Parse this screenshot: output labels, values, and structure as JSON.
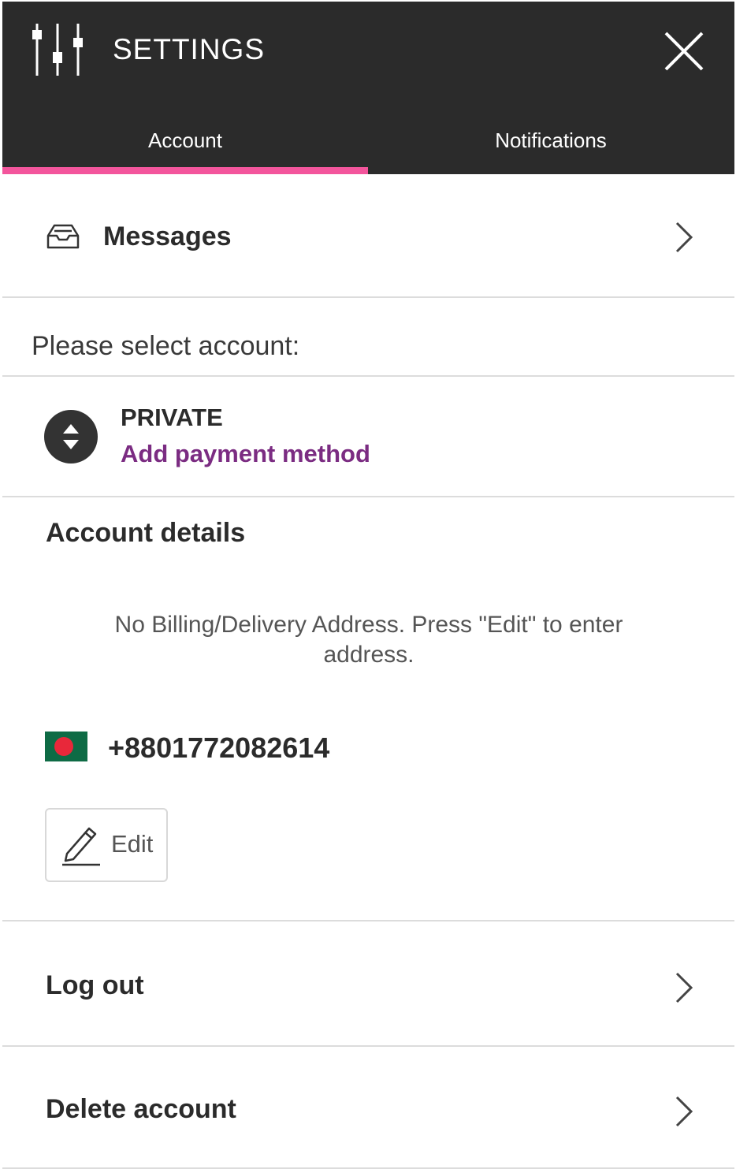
{
  "header": {
    "title": "SETTINGS",
    "settings_icon": "sliders-icon",
    "close_icon": "close-icon",
    "background": "#2b2b2b",
    "accent": "#f3559c"
  },
  "tabs": [
    {
      "label": "Account",
      "active": true
    },
    {
      "label": "Notifications",
      "active": false
    }
  ],
  "messages": {
    "label": "Messages",
    "icon": "inbox-icon"
  },
  "account_select": {
    "prompt": "Please select account:",
    "name": "PRIVATE",
    "add_payment": "Add payment method",
    "link_color": "#7b2c82"
  },
  "account_details": {
    "title": "Account details",
    "address_notice": "No Billing/Delivery Address. Press \"Edit\" to enter address.",
    "phone": "+8801772082614",
    "flag_icon": "bangladesh-flag-icon",
    "edit_label": "Edit"
  },
  "actions": {
    "logout": "Log out",
    "delete": "Delete account"
  }
}
